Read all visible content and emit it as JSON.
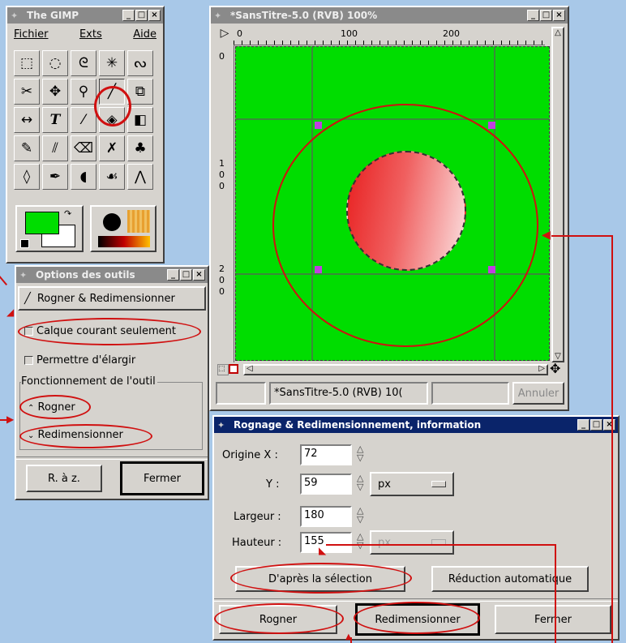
{
  "gimp_toolbox": {
    "title": "The GIMP",
    "menu": [
      "Fichier",
      "Exts",
      "Aide"
    ],
    "tools": [
      "rect-select",
      "ellipse-select",
      "lasso",
      "fuzzy-select",
      "bezier",
      "scissors",
      "move",
      "magnify",
      "crop",
      "transform",
      "flip",
      "text",
      "color-picker",
      "bucket-fill",
      "blend",
      "pencil",
      "paintbrush",
      "eraser",
      "airbrush",
      "clone",
      "convolve",
      "ink",
      "dodge",
      "smudge",
      "measure"
    ]
  },
  "image_window": {
    "title": "*SansTitre-5.0 (RVB) 100%",
    "ruler_top": [
      "0",
      "100",
      "200"
    ],
    "ruler_left": [
      "0",
      "1",
      "0",
      "0",
      "2",
      "0",
      "0"
    ],
    "status": "*SansTitre-5.0 (RVB) 10(",
    "cancel_label": "Annuler",
    "canvas_color": "#00dd00"
  },
  "tool_options": {
    "title": "Options des outils",
    "tool_name": "Rogner & Redimensionner",
    "current_layer_only": "Calque courant seulement",
    "allow_grow": "Permettre d'élargir",
    "mode_group": "Fonctionnement de l'outil",
    "mode_crop": "Rogner",
    "mode_resize": "Redimensionner",
    "reset_label": "R. à z.",
    "close_label": "Fermer"
  },
  "crop_dialog": {
    "title": "Rognage & Redimensionnement, information",
    "origin_x_label": "Origine X :",
    "origin_x": "72",
    "y_label": "Y :",
    "y": "59",
    "unit": "px",
    "width_label": "Largeur :",
    "width": "180",
    "height_label": "Hauteur :",
    "height": "155",
    "unit2": "px",
    "from_selection": "D'après la sélection",
    "auto_shrink": "Réduction automatique",
    "crop_btn": "Rogner",
    "resize_btn": "Redimensionner",
    "close_btn": "Fermer"
  },
  "colors": {
    "annotation": "#d01010",
    "desktop": "#a8c8e8",
    "title_active": "#0a246a"
  }
}
